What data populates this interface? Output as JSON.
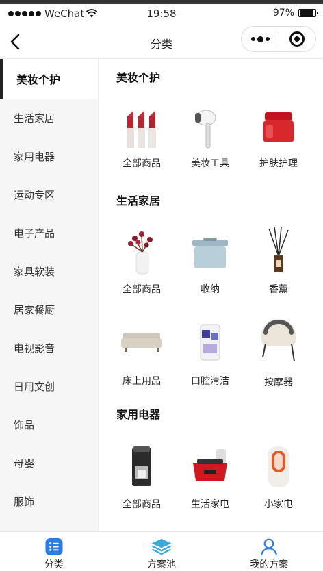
{
  "status_bar": {
    "carrier": "WeChat",
    "time": "19:58",
    "battery": "97%"
  },
  "nav": {
    "title": "分类"
  },
  "sidebar": {
    "items": [
      {
        "label": "美妆个护",
        "active": true
      },
      {
        "label": "生活家居"
      },
      {
        "label": "家用电器"
      },
      {
        "label": "运动专区"
      },
      {
        "label": "电子产品"
      },
      {
        "label": "家具软装"
      },
      {
        "label": "居家餐厨"
      },
      {
        "label": "电视影音"
      },
      {
        "label": "日用文创"
      },
      {
        "label": "饰品"
      },
      {
        "label": "母婴"
      },
      {
        "label": "服饰"
      }
    ]
  },
  "sections": [
    {
      "title": "美妆个护",
      "items": [
        {
          "label": "全部商品",
          "icon": "lipstick-icon"
        },
        {
          "label": "美妆工具",
          "icon": "hair-dryer-icon"
        },
        {
          "label": "护肤护理",
          "icon": "cream-jar-icon"
        }
      ]
    },
    {
      "title": "生活家居",
      "items": [
        {
          "label": "全部商品",
          "icon": "flower-vase-icon"
        },
        {
          "label": "收纳",
          "icon": "storage-box-icon"
        },
        {
          "label": "香薰",
          "icon": "reed-diffuser-icon"
        },
        {
          "label": "床上用品",
          "icon": "sofa-icon"
        },
        {
          "label": "口腔清洁",
          "icon": "toothpaste-icon"
        },
        {
          "label": "按摩器",
          "icon": "neck-massager-icon"
        }
      ]
    },
    {
      "title": "家用电器",
      "items": [
        {
          "label": "全部商品",
          "icon": "coffee-machine-icon"
        },
        {
          "label": "生活家电",
          "icon": "electric-grill-icon"
        },
        {
          "label": "小家电",
          "icon": "heater-icon"
        }
      ]
    }
  ],
  "tabbar": {
    "items": [
      {
        "label": "分类",
        "icon": "list-icon",
        "active": true
      },
      {
        "label": "方案池",
        "icon": "layers-icon"
      },
      {
        "label": "我的方案",
        "icon": "user-icon"
      }
    ]
  },
  "colors": {
    "accent": "#2a7de1",
    "layers": "#3aa9d8",
    "sidebar_bg": "#f6f6f6"
  }
}
